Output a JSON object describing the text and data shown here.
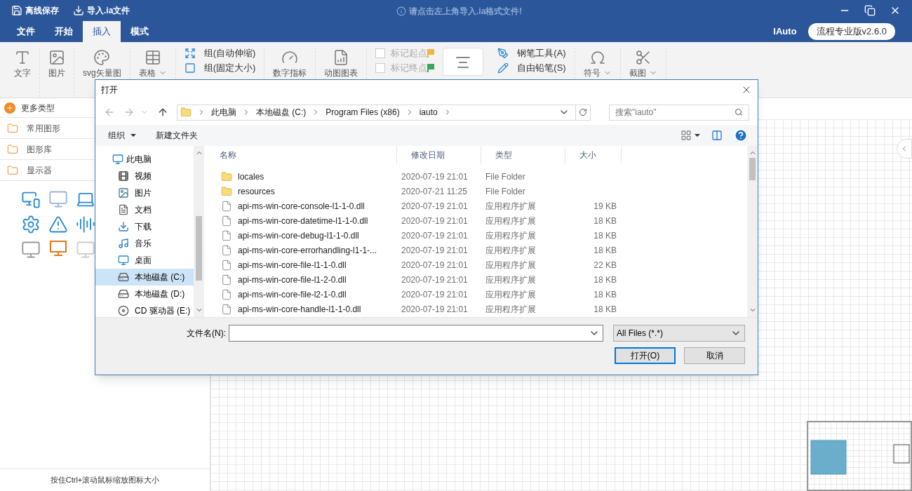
{
  "app": {
    "title_actions": [
      {
        "kind": "save",
        "label": "离线保存"
      },
      {
        "kind": "import",
        "label": "导入.ia文件"
      }
    ],
    "notice": "请点击左上角导入.ia格式文件!",
    "user": "IAuto",
    "edition": "流程专业版v2.6.0"
  },
  "tabs": [
    {
      "label": "文件",
      "selected": false
    },
    {
      "label": "开始",
      "selected": false
    },
    {
      "label": "插入",
      "selected": true
    },
    {
      "label": "模式",
      "selected": false
    }
  ],
  "ribbon": [
    {
      "kind": "big",
      "label": "文字"
    },
    {
      "kind": "big",
      "label": "图片"
    },
    {
      "kind": "big",
      "label": "svg矢量图"
    },
    {
      "kind": "big",
      "label": "表格",
      "caret": true
    },
    {
      "kind": "pair",
      "items": [
        {
          "label": "组(自动伸缩)"
        },
        {
          "label": "组(固定大小)"
        }
      ]
    },
    {
      "kind": "big",
      "label": "数字指标"
    },
    {
      "kind": "big",
      "label": "动图图表"
    },
    {
      "kind": "checks",
      "items": [
        {
          "label": "标记起点",
          "checked": false,
          "color": "#f5b13d"
        },
        {
          "label": "标记终点",
          "checked": false,
          "color": "#3aa657"
        }
      ]
    },
    {
      "kind": "boxed"
    },
    {
      "kind": "pair",
      "items": [
        {
          "label": "钢笔工具(A)"
        },
        {
          "label": "自由铅笔(S)"
        }
      ]
    },
    {
      "kind": "big",
      "label": "符号",
      "caret": true
    },
    {
      "kind": "big",
      "label": "截图",
      "caret": true
    }
  ],
  "sidebar": {
    "header": "更多类型",
    "groups": [
      "常用图形",
      "图形库",
      "显示器"
    ],
    "hint": "按住Ctrl+滚动鼠标缩放图标大小"
  },
  "dialog": {
    "title": "打开",
    "path": [
      "此电脑",
      "本地磁盘 (C:)",
      "Program Files (x86)",
      "iauto"
    ],
    "search": {
      "placeholder": "搜索\"iauto\""
    },
    "toolbar": [
      "组织",
      "新建文件夹"
    ],
    "nav": [
      {
        "label": "此电脑",
        "selected": false,
        "children": [
          {
            "label": "视频",
            "selected": false
          },
          {
            "label": "图片",
            "selected": false
          },
          {
            "label": "文档",
            "selected": false
          },
          {
            "label": "下载",
            "selected": false
          },
          {
            "label": "音乐",
            "selected": false
          },
          {
            "label": "桌面",
            "selected": false
          },
          {
            "label": "本地磁盘 (C:)",
            "selected": true
          },
          {
            "label": "本地磁盘 (D:)",
            "selected": false
          },
          {
            "label": "CD 驱动器 (E:)",
            "selected": false
          }
        ]
      }
    ],
    "columns": [
      "名称",
      "修改日期",
      "类型",
      "大小"
    ],
    "files": [
      {
        "kind": "folder",
        "name": "locales",
        "date": "2020-07-19 21:01",
        "type": "File Folder"
      },
      {
        "kind": "folder",
        "name": "resources",
        "date": "2020-07-21 11:25",
        "type": "File Folder"
      },
      {
        "kind": "file",
        "name": "api-ms-win-core-console-l1-1-0.dll",
        "date": "2020-07-19 21:01",
        "type": "应用程序扩展",
        "size": "19 KB"
      },
      {
        "kind": "file",
        "name": "api-ms-win-core-datetime-l1-1-0.dll",
        "date": "2020-07-19 21:01",
        "type": "应用程序扩展",
        "size": "18 KB"
      },
      {
        "kind": "file",
        "name": "api-ms-win-core-debug-l1-1-0.dll",
        "date": "2020-07-19 21:01",
        "type": "应用程序扩展",
        "size": "18 KB"
      },
      {
        "kind": "file",
        "name": "api-ms-win-core-errorhandling-l1-1-...",
        "date": "2020-07-19 21:01",
        "type": "应用程序扩展",
        "size": "18 KB"
      },
      {
        "kind": "file",
        "name": "api-ms-win-core-file-l1-1-0.dll",
        "date": "2020-07-19 21:01",
        "type": "应用程序扩展",
        "size": "22 KB"
      },
      {
        "kind": "file",
        "name": "api-ms-win-core-file-l1-2-0.dll",
        "date": "2020-07-19 21:01",
        "type": "应用程序扩展",
        "size": "18 KB"
      },
      {
        "kind": "file",
        "name": "api-ms-win-core-file-l2-1-0.dll",
        "date": "2020-07-19 21:01",
        "type": "应用程序扩展",
        "size": "18 KB"
      },
      {
        "kind": "file",
        "name": "api-ms-win-core-handle-l1-1-0.dll",
        "date": "2020-07-19 21:01",
        "type": "应用程序扩展",
        "size": "18 KB"
      }
    ],
    "filename_label": "文件名(N):",
    "filter": "All Files (*.*)",
    "buttons": [
      {
        "label": "打开(O)",
        "primary": true
      },
      {
        "label": "取消",
        "primary": false
      }
    ]
  }
}
